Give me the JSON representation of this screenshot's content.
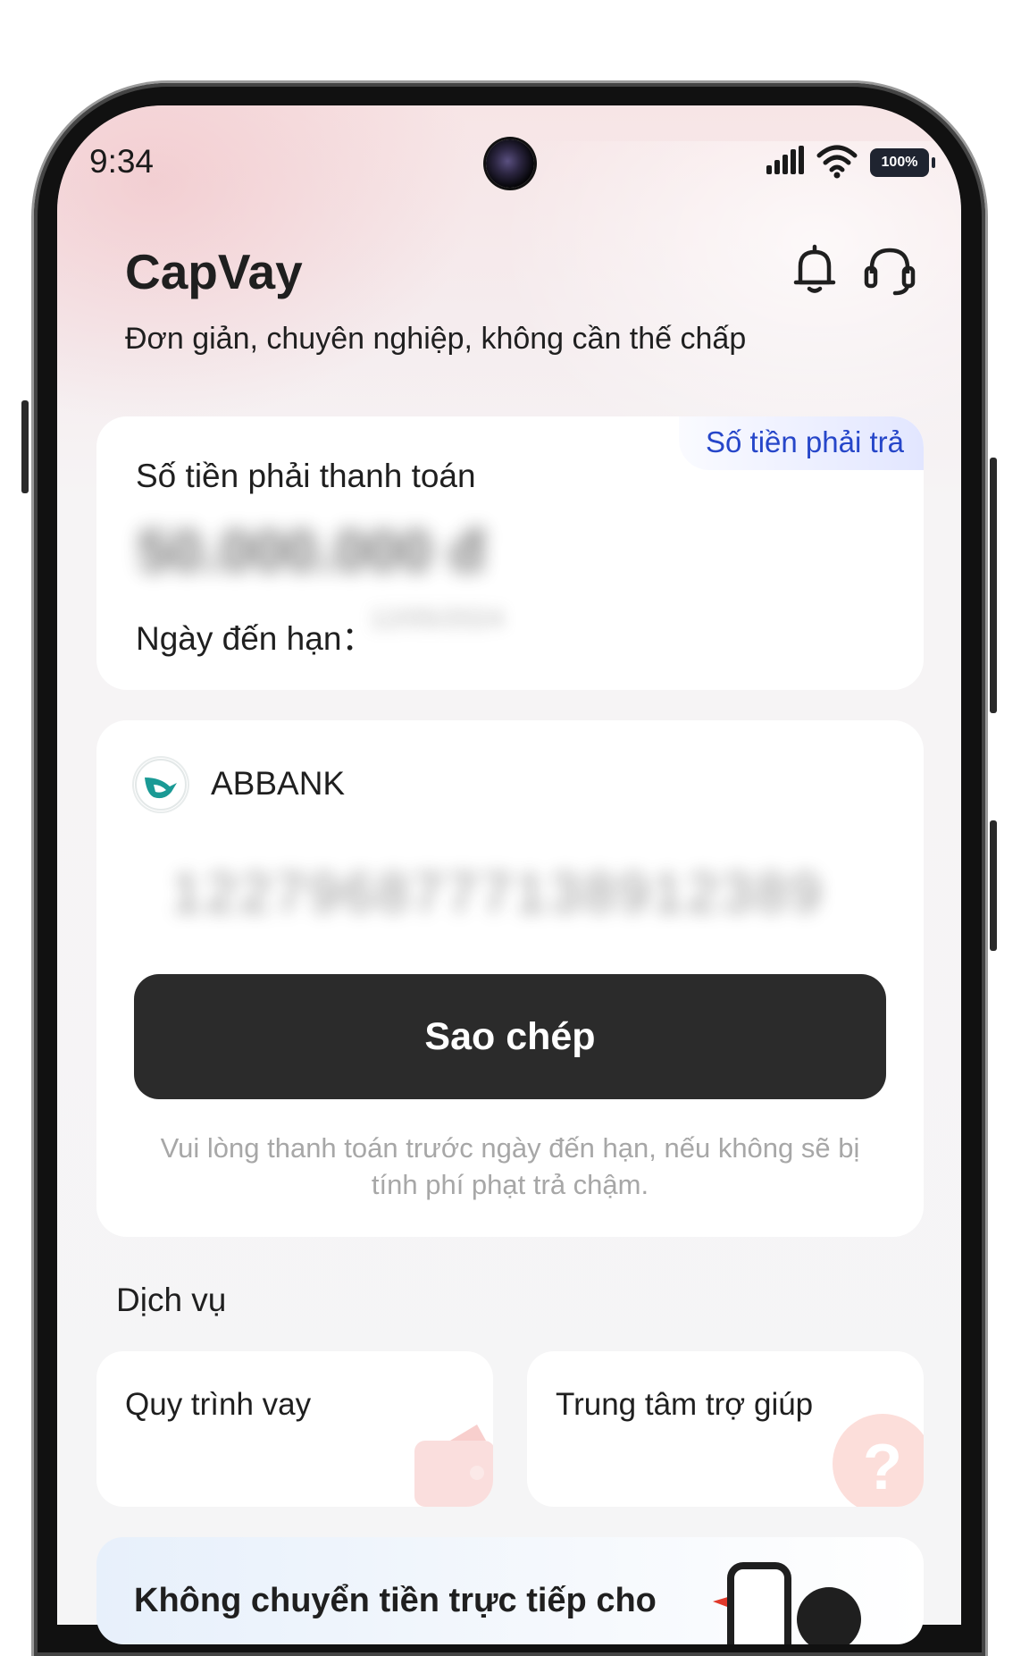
{
  "status_bar": {
    "time": "9:34",
    "battery": "100%"
  },
  "header": {
    "title": "CapVay",
    "subtitle": "Đơn giản, chuyên nghiệp, không cần thế chấp"
  },
  "payment_card": {
    "tag": "Số tiền phải trả",
    "amount_label": "Số tiền phải thanh toán",
    "amount_value": "50.000.000 đ",
    "due_label": "Ngày đến hạn：",
    "due_value": "12/05/2024"
  },
  "bank_card": {
    "bank_name": "ABBANK",
    "account_number": "1227968777138912389",
    "copy_button": "Sao chép",
    "note": "Vui lòng thanh toán trước ngày đến hạn, nếu không sẽ bị tính phí phạt trả chậm."
  },
  "services": {
    "title": "Dịch vụ",
    "items": [
      {
        "label": "Quy trình vay"
      },
      {
        "label": "Trung tâm trợ giúp"
      }
    ]
  },
  "banner": {
    "text": "Không chuyển tiền trực tiếp cho"
  },
  "colors": {
    "accent_blue": "#2646c9",
    "button_dark": "#2b2b2b",
    "bank_teal": "#1a9a95"
  }
}
